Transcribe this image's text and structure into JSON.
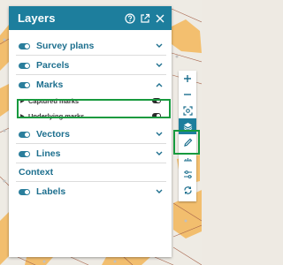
{
  "panel": {
    "title": "Layers",
    "header_icons": [
      "help-icon",
      "popout-icon",
      "close-icon"
    ]
  },
  "groups": [
    {
      "label": "Survey plans",
      "toggle": "on",
      "chevron": "down"
    },
    {
      "label": "Parcels",
      "toggle": "on",
      "chevron": "down"
    },
    {
      "label": "Marks",
      "toggle": "on",
      "chevron": "up"
    },
    {
      "label": "Vectors",
      "toggle": "on",
      "chevron": "down"
    },
    {
      "label": "Lines",
      "toggle": "on",
      "chevron": "down"
    }
  ],
  "marks_sublayers": [
    {
      "label": "Captured marks",
      "toggle": "on"
    },
    {
      "label": "Underlying marks",
      "toggle": "on"
    }
  ],
  "context": {
    "label": "Context",
    "groups": [
      {
        "label": "Labels",
        "toggle": "on",
        "chevron": "down"
      }
    ]
  },
  "toolbar": {
    "buttons": [
      "zoom-in-icon",
      "zoom-out-icon",
      "zoom-extent-icon",
      "layers-icon",
      "edit-pencil-icon",
      "measure-icon",
      "settings-sliders-icon",
      "sync-icon"
    ],
    "active": "layers-icon",
    "highlighted": "edit-pencil-icon"
  },
  "colors": {
    "header": "#1d7e9d",
    "label": "#1d6f8e",
    "highlight": "#179a3e",
    "map_parcel": "#f2b65e",
    "map_line": "#a8624a"
  }
}
